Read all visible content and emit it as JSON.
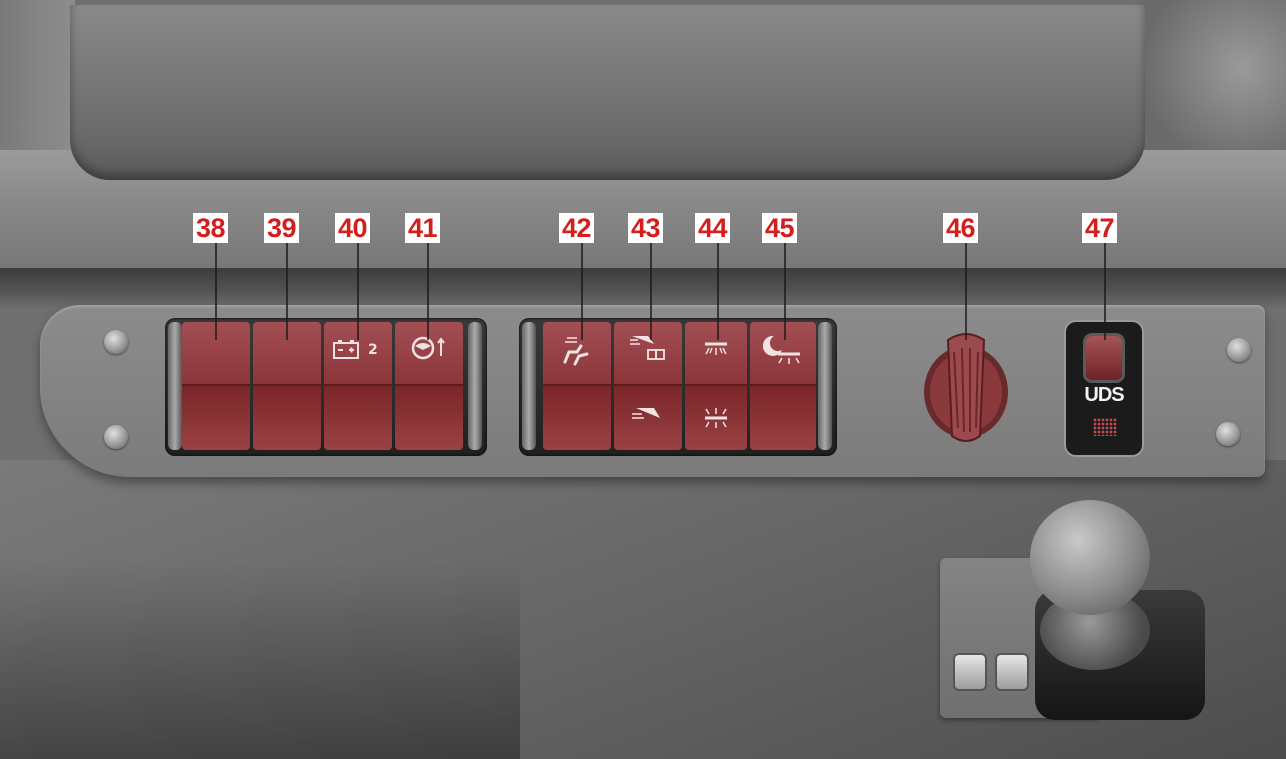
{
  "labels": {
    "l38": "38",
    "l39": "39",
    "l40": "40",
    "l41": "41",
    "l42": "42",
    "l43": "43",
    "l44": "44",
    "l45": "45",
    "l46": "46",
    "l47": "47"
  },
  "switch_bank_left": [
    {
      "id": "38",
      "symbol": "",
      "icon": "blank-switch"
    },
    {
      "id": "39",
      "symbol": "",
      "icon": "blank-switch"
    },
    {
      "id": "40",
      "symbol": "2",
      "icon": "battery-icon"
    },
    {
      "id": "41",
      "symbol": "",
      "icon": "steering-wheel-icon"
    }
  ],
  "switch_bank_right": [
    {
      "id": "42",
      "icon": "seat-heater-icon"
    },
    {
      "id": "43",
      "icon": "reading-light-icon"
    },
    {
      "id": "44",
      "icon": "interior-light-icon"
    },
    {
      "id": "45",
      "icon": "night-light-icon"
    }
  ],
  "socket": {
    "icon": "power-socket-cap-icon"
  },
  "uds": {
    "text": "UDS",
    "icon": "uds-switch-icon"
  },
  "colors": {
    "label_text": "#d41e1e",
    "label_bg": "#ffffff",
    "switch_red": "#8b3539"
  }
}
